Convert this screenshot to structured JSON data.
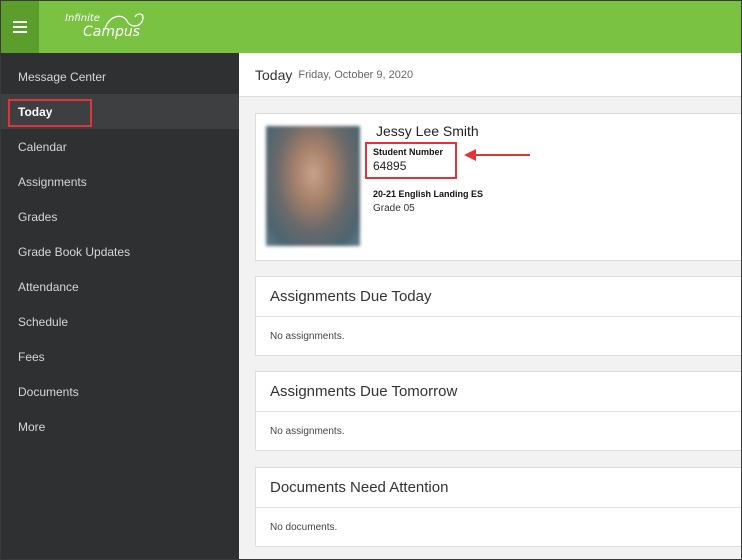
{
  "app": {
    "logo_line1": "Infinite",
    "logo_line2": "Campus",
    "accent_color": "#79c242",
    "highlight_color": "#e0343b"
  },
  "sidebar": {
    "items": [
      {
        "label": "Message Center"
      },
      {
        "label": "Today"
      },
      {
        "label": "Calendar"
      },
      {
        "label": "Assignments"
      },
      {
        "label": "Grades"
      },
      {
        "label": "Grade Book Updates"
      },
      {
        "label": "Attendance"
      },
      {
        "label": "Schedule"
      },
      {
        "label": "Fees"
      },
      {
        "label": "Documents"
      },
      {
        "label": "More"
      }
    ],
    "active_item": "Today"
  },
  "header": {
    "title": "Today",
    "date": "Friday, October 9, 2020"
  },
  "student": {
    "name": "Jessy Lee Smith",
    "number_label": "Student Number",
    "number": "64895",
    "school": "20-21 English Landing ES",
    "grade": "Grade 05"
  },
  "sections": [
    {
      "title": "Assignments Due Today",
      "empty_text": "No assignments."
    },
    {
      "title": "Assignments Due Tomorrow",
      "empty_text": "No assignments."
    },
    {
      "title": "Documents Need Attention",
      "empty_text": "No documents."
    }
  ],
  "icons": {
    "menu": "hamburger-menu-icon",
    "annotation": "red-arrow-icon"
  }
}
